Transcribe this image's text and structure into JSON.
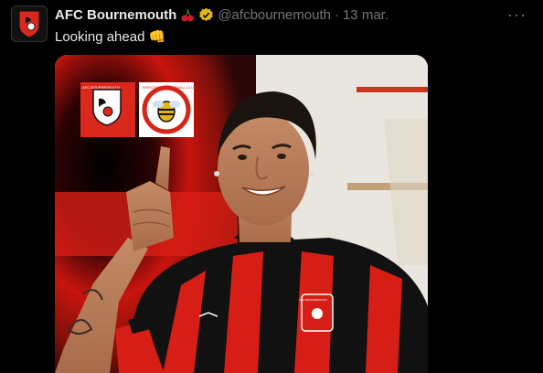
{
  "account": {
    "name": "AFC Bournemouth",
    "handle": "@afcbournemouth",
    "separator": "·",
    "date": "13 mar."
  },
  "tweet": {
    "text": "Looking ahead",
    "emoji": "👊"
  },
  "menu": {
    "more_label": "···"
  },
  "media": {
    "alt": "Player pointing up with AFC Bournemouth and Brentford crests",
    "crest_left": "AFC BOURNEMOUTH",
    "crest_right": "BRENTFORD FOOTBALL CLUB",
    "shirt_crest": "AFC BOURNEMOUTH"
  },
  "colors": {
    "bg": "#000000",
    "text": "#e7e9ea",
    "muted": "#71767b",
    "verified": "#e2b719",
    "red": "#da291c",
    "black": "#111111"
  },
  "icons": [
    "cherries-emoji-icon",
    "verified-badge-icon",
    "more-options-icon"
  ]
}
